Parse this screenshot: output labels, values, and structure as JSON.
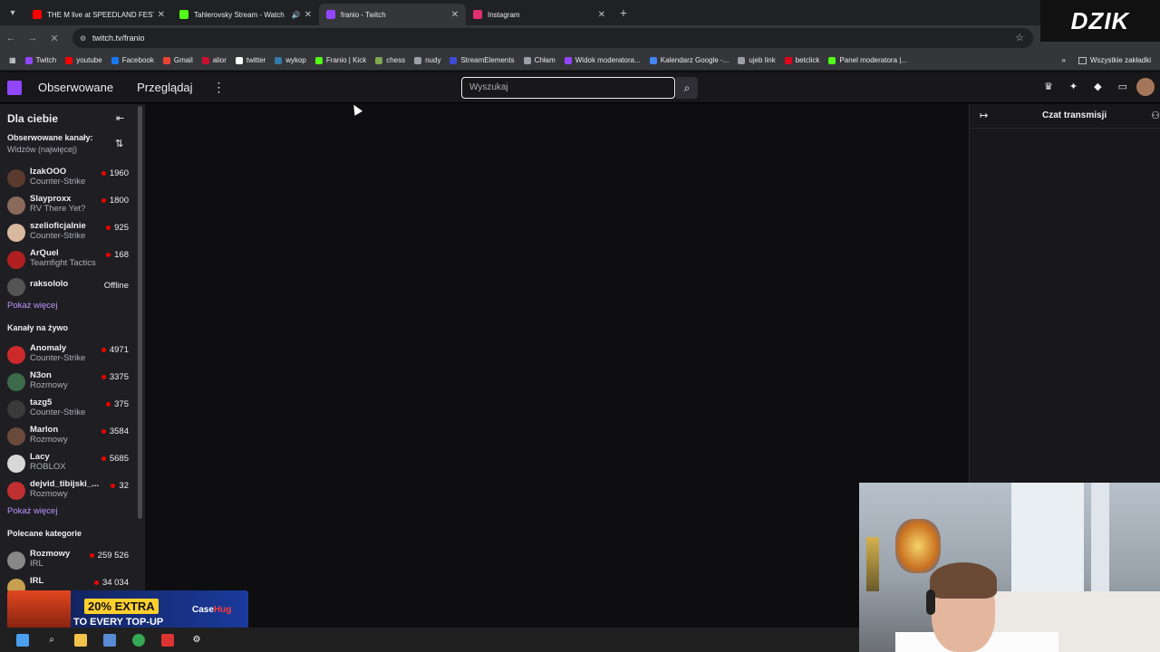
{
  "browser": {
    "tabs": [
      {
        "title": "THE M live at SPEEDLAND FEST",
        "favicon_color": "#ff0000",
        "active": false,
        "audio": false
      },
      {
        "title": "Tahlerovsky Stream - Watch",
        "favicon_color": "#53fc18",
        "active": false,
        "audio": true
      },
      {
        "title": "franio - Twitch",
        "favicon_color": "#9146ff",
        "active": true,
        "audio": false
      },
      {
        "title": "Instagram",
        "favicon_color": "#e1306c",
        "active": false,
        "audio": false
      }
    ],
    "url": "twitch.tv/franio",
    "bookmarks": [
      {
        "label": "Twitch",
        "color": "#9146ff"
      },
      {
        "label": "youtube",
        "color": "#ff0000"
      },
      {
        "label": "Facebook",
        "color": "#1877f2"
      },
      {
        "label": "Gmail",
        "color": "#ea4335"
      },
      {
        "label": "alior",
        "color": "#c8102e"
      },
      {
        "label": "twitter",
        "color": "#ffffff"
      },
      {
        "label": "wykop",
        "color": "#367aa9"
      },
      {
        "label": "Franio | Kick",
        "color": "#53fc18"
      },
      {
        "label": "chess",
        "color": "#7fa650"
      },
      {
        "label": "nudy",
        "color": "#9aa0a6"
      },
      {
        "label": "StreamElements",
        "color": "#3c4bd6"
      },
      {
        "label": "Chłam",
        "color": "#9aa0a6"
      },
      {
        "label": "Widok moderatora...",
        "color": "#9146ff"
      },
      {
        "label": "Kalendarz Google -...",
        "color": "#4285f4"
      },
      {
        "label": "ujeb link",
        "color": "#9aa0a6"
      },
      {
        "label": "betclick",
        "color": "#e2001a"
      },
      {
        "label": "Panel moderatora |...",
        "color": "#53fc18"
      }
    ],
    "all_bookmarks": "Wszystkie zakładki",
    "overlay_logo": "DZIK"
  },
  "twitch": {
    "nav_following": "Obserwowane",
    "nav_browse": "Przeglądaj",
    "search_placeholder": "Wyszukaj",
    "sidebar": {
      "title": "Dla ciebie",
      "followed_title": "Obserwowane kanały:",
      "followed_sort": "Widzów (najwięcej)",
      "followed": [
        {
          "name": "IzakOOO",
          "game": "Counter-Strike",
          "viewers": "1960",
          "avatar_color": "#5a3b2e"
        },
        {
          "name": "Slayproxx",
          "game": "RV There Yet?",
          "viewers": "1800",
          "avatar_color": "#8a6a5a"
        },
        {
          "name": "szelioficjalnie",
          "game": "Counter-Strike",
          "viewers": "925",
          "avatar_color": "#d9b8a0"
        },
        {
          "name": "ArQuel",
          "game": "Teamfight Tactics",
          "viewers": "168",
          "avatar_color": "#b02020"
        },
        {
          "name": "raksololo",
          "game": "",
          "viewers": "Offline",
          "avatar_color": "#555555"
        }
      ],
      "show_more_1": "Pokaż więcej",
      "live_title": "Kanały na żywo",
      "live": [
        {
          "name": "Anomaly",
          "game": "Counter-Strike",
          "viewers": "4971",
          "avatar_color": "#cc2a2a"
        },
        {
          "name": "N3on",
          "game": "Rozmowy",
          "viewers": "3375",
          "avatar_color": "#3b6b4a"
        },
        {
          "name": "tazg5",
          "game": "Counter-Strike",
          "viewers": "375",
          "avatar_color": "#3a3a3a"
        },
        {
          "name": "Marlon",
          "game": "Rozmowy",
          "viewers": "3584",
          "avatar_color": "#6a4a3a"
        },
        {
          "name": "Lacy",
          "game": "ROBLOX",
          "viewers": "5685",
          "avatar_color": "#d8d8d8"
        },
        {
          "name": "dejvid_tibijski_...",
          "game": "Rozmowy",
          "viewers": "32",
          "avatar_color": "#c03030"
        }
      ],
      "show_more_2": "Pokaż więcej",
      "categories_title": "Polecane kategorie",
      "categories": [
        {
          "name": "Rozmowy",
          "tag": "IRL",
          "viewers": "259 526",
          "avatar_color": "#888888"
        },
        {
          "name": "IRL",
          "tag": "",
          "viewers": "34 034",
          "avatar_color": "#c6a050"
        }
      ]
    },
    "chat_title": "Czat transmisji"
  },
  "ad": {
    "headline": "20% EXTRA",
    "subline": "TO EVERY TOP-UP",
    "brand_a": "Case",
    "brand_b": "Hug"
  }
}
